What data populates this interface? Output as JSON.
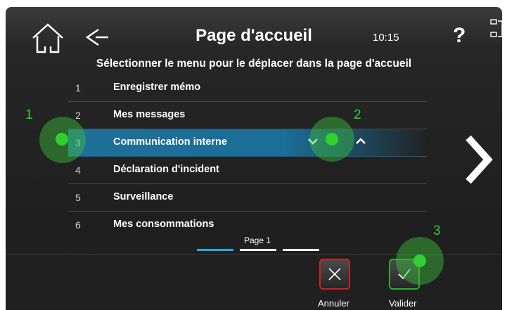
{
  "header": {
    "title": "Page d'accueil",
    "time": "10:15",
    "help": "?",
    "icons": {
      "home": "home-icon",
      "back": "back-arrow-icon",
      "expand": "expand-window-icon"
    }
  },
  "subtitle": "Sélectionner le menu pour le déplacer dans la page d'accueil",
  "menu": {
    "items": [
      {
        "number": "1",
        "label": "Enregistrer mémo",
        "selected": false
      },
      {
        "number": "2",
        "label": "Mes messages",
        "selected": false
      },
      {
        "number": "3",
        "label": "Communication interne",
        "selected": true
      },
      {
        "number": "4",
        "label": "Déclaration d'incident",
        "selected": false
      },
      {
        "number": "5",
        "label": "Surveillance",
        "selected": false
      },
      {
        "number": "6",
        "label": "Mes consommations",
        "selected": false
      }
    ]
  },
  "pager": {
    "label": "Page 1",
    "current": 1,
    "total": 3
  },
  "actions": {
    "cancel_label": "Annuler",
    "validate_label": "Valider"
  },
  "annotations": {
    "m1": "1",
    "m2": "2",
    "m3": "3"
  },
  "colors": {
    "selection": "#1f6f97",
    "active_page": "#27a8e6",
    "cancel_border": "#d11f1f",
    "validate_border": "#26b026",
    "marker": "#2fd02f"
  }
}
